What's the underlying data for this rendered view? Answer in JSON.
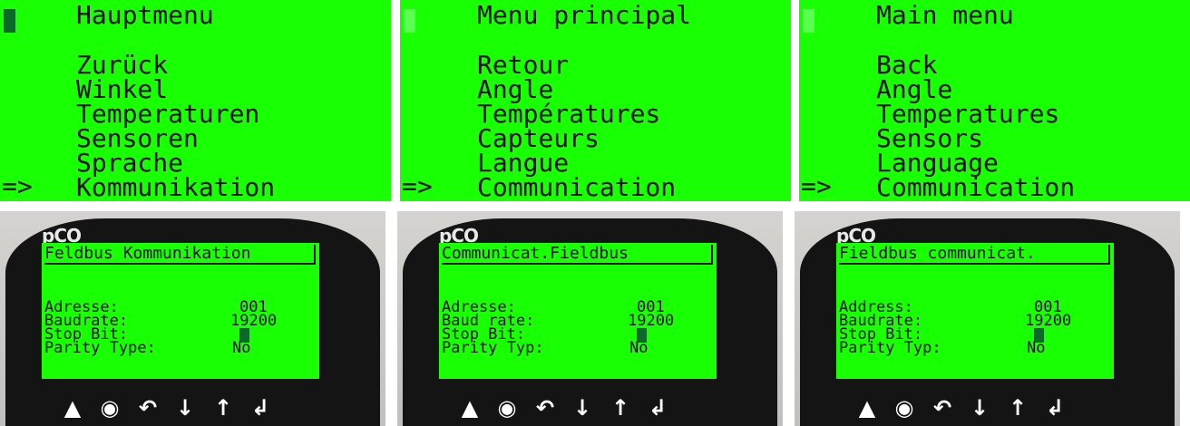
{
  "colors": {
    "lcd_green": "#19ff03",
    "cursor_dark": "#0b6a2a",
    "cursor_light": "#5bff52",
    "bezel": "#141414",
    "case": "#cccac6"
  },
  "menus": [
    {
      "title": "Hauptmenu",
      "items": [
        "Zurück",
        "Winkel",
        "Temperaturen",
        "Sensoren",
        "Sprache",
        "Kommunikation"
      ],
      "selector": "=>"
    },
    {
      "title": "Menu principal",
      "items": [
        "Retour",
        "Angle",
        "Températures",
        "Capteurs",
        "Langue",
        "Communication"
      ],
      "selector": "=>"
    },
    {
      "title": "Main menu",
      "items": [
        "Back",
        "Angle",
        "Temperatures",
        "Sensors",
        "Language",
        "Communication"
      ],
      "selector": "=>"
    }
  ],
  "devices": [
    {
      "logo": "pCO",
      "title": "Feldbus Kommunikation",
      "labels": [
        "Adresse:",
        "Baudrate:",
        "Stop Bit:",
        "Parity Type:"
      ],
      "values": {
        "address": "001",
        "baud": "19200",
        "parity": "No"
      }
    },
    {
      "logo": "pCO",
      "title": "Communicat.Fieldbus",
      "labels": [
        "Adresse:",
        "Baud rate:",
        "Stop Bit:",
        "Parity Typ:"
      ],
      "values": {
        "address": "001",
        "baud": "19200",
        "parity": "No"
      }
    },
    {
      "logo": "pCO",
      "title": "Fieldbus communicat.",
      "labels": [
        "Address:",
        "Baudrate:",
        "Stop Bit:",
        "Parity Typ:"
      ],
      "values": {
        "address": "001",
        "baud": "19200",
        "parity": "No"
      }
    }
  ],
  "keypad": [
    {
      "icon": "alarm-icon",
      "glyph": "▲"
    },
    {
      "icon": "program-icon",
      "glyph": "◉"
    },
    {
      "icon": "escape-icon",
      "glyph": "↶"
    },
    {
      "icon": "down-icon",
      "glyph": "↓"
    },
    {
      "icon": "up-icon",
      "glyph": "↑"
    },
    {
      "icon": "enter-icon",
      "glyph": "↲"
    }
  ]
}
